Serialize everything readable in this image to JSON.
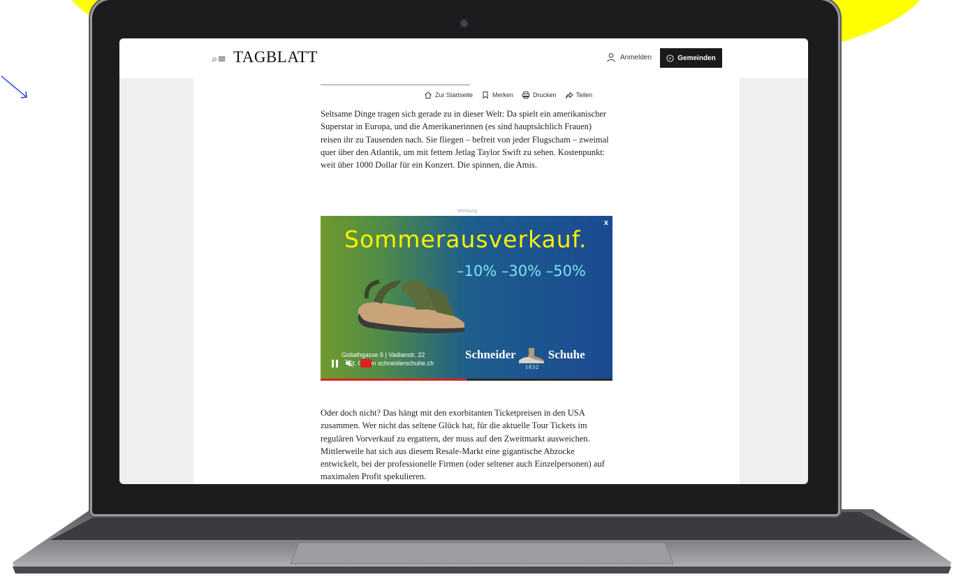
{
  "header": {
    "logo": "TAGBLATT",
    "login_label": "Anmelden",
    "gemeinden_label": "Gemeinden"
  },
  "article_actions": [
    {
      "label": "Zur Startseite",
      "icon": "home-icon"
    },
    {
      "label": "Merken",
      "icon": "bookmark-icon"
    },
    {
      "label": "Drucken",
      "icon": "print-icon"
    },
    {
      "label": "Teilen",
      "icon": "share-icon"
    }
  ],
  "article": {
    "paragraph_1": "Seltsame Dinge tragen sich gerade zu in dieser Welt: Da spielt ein amerikanischer Superstar in Europa, und die Amerikanerinnen (es sind hauptsächlich Frauen) reisen ihr zu Tausenden nach. Sie fliegen – befreit von jeder Flugscham – zweimal quer über den Atlantik, um mit fettem Jetlag Taylor Swift zu sehen. Kostenpunkt: weit über 1000 Dollar für ein Konzert. Die spinnen, die Amis.",
    "paragraph_2": "Oder doch nicht? Das hängt mit den exorbitanten Ticketpreisen in den USA zusammen. Wer nicht das seltene Glück hat, für die aktuelle Tour Tickets im regulären Vorverkauf zu ergattern, der muss auf den Zweitmarkt ausweichen. Mittlerweile hat sich aus diesem Resale-Markt eine gigantische Abzocke entwickelt, bei der professionelle Firmen (oder seltener auch Einzelpersonen) auf maximalen Profit spekulieren."
  },
  "ad": {
    "label": "Werbung",
    "close": "x",
    "headline": "Sommerausverkauf.",
    "discounts": "–10% –30% –50%",
    "address_line1": "Goliathgasse 5 | Vadianstr. 22",
    "address_line2": "St. Gallen   schneiderschuhe.ch",
    "brand_left": "Schneider",
    "brand_right": "Schuhe",
    "year": "1832",
    "progress": 0.5
  },
  "colors": {
    "ad_headline": "#fff200",
    "ad_discounts": "#7fe4f2",
    "background_accent": "#ffff00",
    "progress": "#e02020"
  }
}
